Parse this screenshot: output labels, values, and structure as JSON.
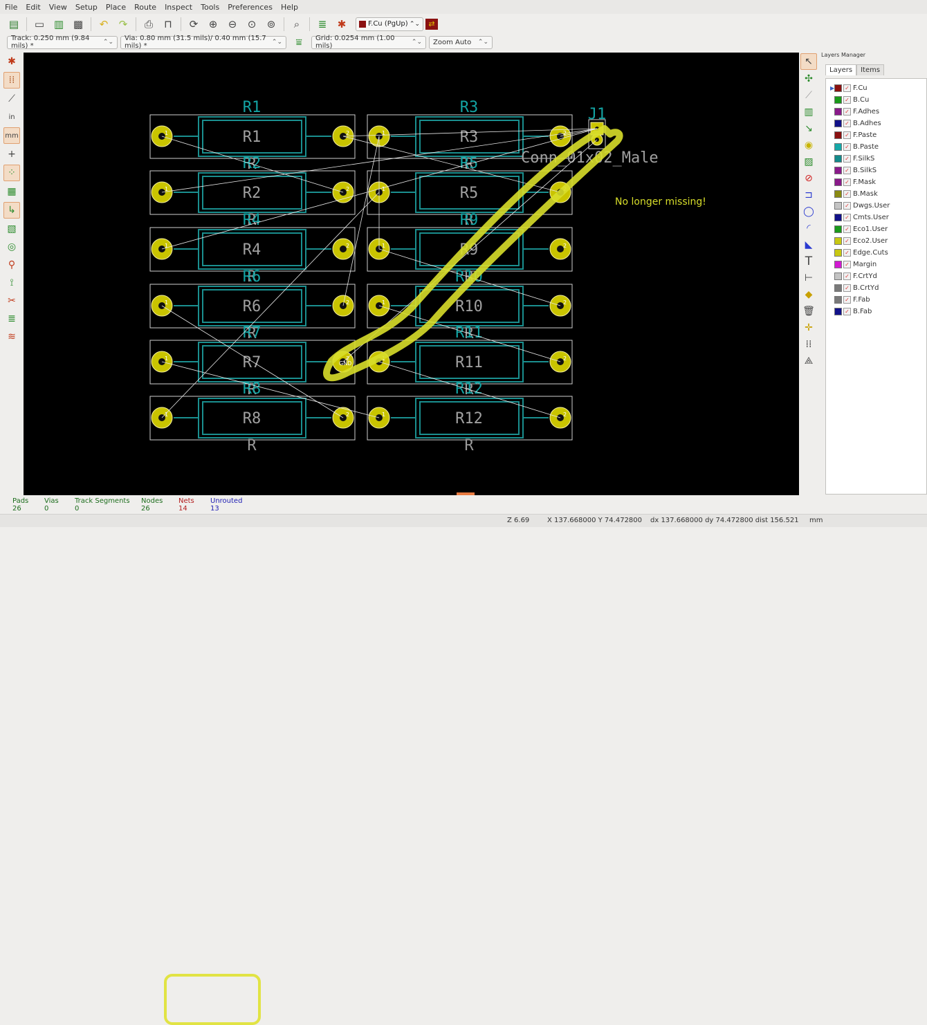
{
  "menu": [
    "File",
    "Edit",
    "View",
    "Setup",
    "Place",
    "Route",
    "Inspect",
    "Tools",
    "Preferences",
    "Help"
  ],
  "toolbar": {
    "icons": [
      "new-board-icon",
      "page-settings-icon",
      "footprint-editor-icon",
      "footprint-browser-icon",
      "undo-icon",
      "redo-icon",
      "print-icon",
      "plot-icon",
      "redraw-icon",
      "zoom-in-icon",
      "zoom-out-icon",
      "zoom-fit-icon",
      "zoom-selection-icon",
      "find-icon",
      "netlist-icon",
      "drc-icon"
    ],
    "layer_select": "F.Cu (PgUp)",
    "layer_color": "#8b1111"
  },
  "options": {
    "track": "Track: 0.250 mm (9.84 mils) *",
    "via": "Via: 0.80 mm (31.5 mils)/ 0.40 mm (15.7 mils) *",
    "grid": "Grid: 0.0254 mm (1.00 mils)",
    "zoom": "Zoom Auto"
  },
  "board": {
    "components": [
      {
        "ref": "R1",
        "val": "R"
      },
      {
        "ref": "R3",
        "val": "R"
      },
      {
        "ref": "R2",
        "val": "R"
      },
      {
        "ref": "R5",
        "val": "R"
      },
      {
        "ref": "R4",
        "val": "R"
      },
      {
        "ref": "R9",
        "val": "R"
      },
      {
        "ref": "R6",
        "val": "R"
      },
      {
        "ref": "R10",
        "val": "R"
      },
      {
        "ref": "R7",
        "val": "R"
      },
      {
        "ref": "R11",
        "val": "R"
      },
      {
        "ref": "R8",
        "val": "R"
      },
      {
        "ref": "R12",
        "val": "R"
      }
    ],
    "connector_ref": "J1",
    "connector_value": "Conn_01x02_Male",
    "note": "No longer missing!",
    "pad_numbers": [
      "1",
      "2"
    ],
    "net_label": "GND"
  },
  "layers_manager": {
    "title": "Layers Manager",
    "tabs": [
      "Layers",
      "Items"
    ],
    "layers": [
      {
        "name": "F.Cu",
        "color": "#8b1111",
        "current": true
      },
      {
        "name": "B.Cu",
        "color": "#1a9a1a"
      },
      {
        "name": "F.Adhes",
        "color": "#8a1a8a"
      },
      {
        "name": "B.Adhes",
        "color": "#12128a"
      },
      {
        "name": "F.Paste",
        "color": "#8b1111"
      },
      {
        "name": "B.Paste",
        "color": "#16a8a8"
      },
      {
        "name": "F.SilkS",
        "color": "#138a8a"
      },
      {
        "name": "B.SilkS",
        "color": "#8a1a8a"
      },
      {
        "name": "F.Mask",
        "color": "#8a1a8a"
      },
      {
        "name": "B.Mask",
        "color": "#8a8a12"
      },
      {
        "name": "Dwgs.User",
        "color": "#c4c4c4"
      },
      {
        "name": "Cmts.User",
        "color": "#12128a"
      },
      {
        "name": "Eco1.User",
        "color": "#1a9a1a"
      },
      {
        "name": "Eco2.User",
        "color": "#c8c812"
      },
      {
        "name": "Edge.Cuts",
        "color": "#c8c812"
      },
      {
        "name": "Margin",
        "color": "#d21ad2"
      },
      {
        "name": "F.CrtYd",
        "color": "#c4c4c4"
      },
      {
        "name": "B.CrtYd",
        "color": "#7a7a7a"
      },
      {
        "name": "F.Fab",
        "color": "#7a7a7a"
      },
      {
        "name": "B.Fab",
        "color": "#12128a"
      }
    ]
  },
  "stats": [
    {
      "label": "Pads",
      "value": "26",
      "color": "#1c6d1c"
    },
    {
      "label": "Vias",
      "value": "0",
      "color": "#1c6d1c"
    },
    {
      "label": "Track Segments",
      "value": "0",
      "color": "#1c6d1c"
    },
    {
      "label": "Nodes",
      "value": "26",
      "color": "#1c6d1c"
    },
    {
      "label": "Nets",
      "value": "14",
      "color": "#b31c1c"
    },
    {
      "label": "Unrouted",
      "value": "13",
      "color": "#1c1cb3"
    }
  ],
  "statusbar": {
    "zoom": "Z 6.69",
    "xy": "X 137.668000 Y 74.472800",
    "delta": "dx 137.668000 dy 74.472800 dist 156.521",
    "units": "mm"
  },
  "colors": {
    "pad": "#c9c400",
    "outline": "#1a8f8f",
    "ref": "#13a3a3",
    "val": "#9a9a9a",
    "annotation": "#d8de2a"
  }
}
